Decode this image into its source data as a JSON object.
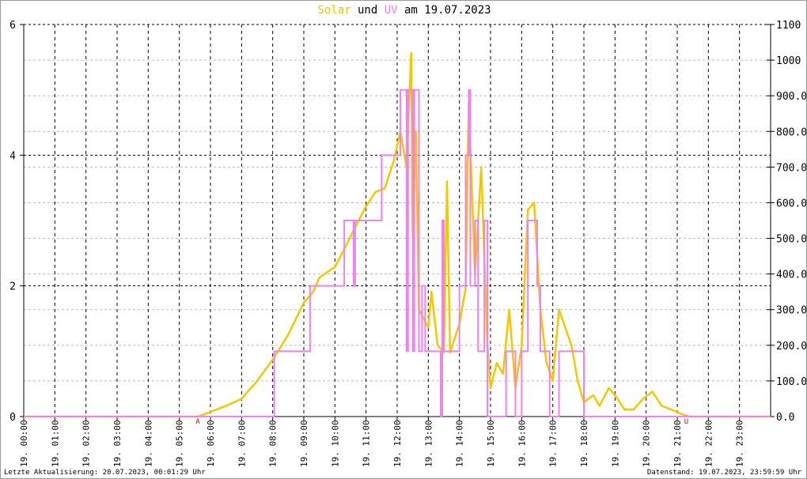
{
  "title": {
    "solar": "Solar",
    "und": " und ",
    "uv": "UV",
    "rest": " am 19.07.2023"
  },
  "footer": {
    "left": "Letzte Aktualisierung: 20.07.2023, 00:01:29 Uhr",
    "right": "Datenstand: 19.07.2023, 23:59:59 Uhr"
  },
  "markers": {
    "sunrise": "A",
    "sunset": "U",
    "sunrise_hour": 5.6,
    "sunset_hour": 21.3
  },
  "colors": {
    "solar": "#f2c800",
    "uv": "#ee82ee",
    "marker": "#e00000"
  },
  "chart_data": {
    "type": "line",
    "title": "Solar und UV am 19.07.2023",
    "x_unit": "hour",
    "xlim": [
      0,
      24
    ],
    "x_tick_labels": [
      "19. 00:00",
      "19. 01:00",
      "19. 02:00",
      "19. 03:00",
      "19. 04:00",
      "19. 05:00",
      "19. 06:00",
      "19. 07:00",
      "19. 08:00",
      "19. 09:00",
      "19. 10:00",
      "19. 11:00",
      "19. 12:00",
      "19. 13:00",
      "19. 14:00",
      "19. 15:00",
      "19. 16:00",
      "19. 17:00",
      "19. 18:00",
      "19. 19:00",
      "19. 20:00",
      "19. 21:00",
      "19. 22:00",
      "19. 23:00"
    ],
    "y_left": {
      "label": "UV",
      "ylim": [
        0,
        6
      ],
      "ticks": [
        "0",
        "2",
        "4",
        "6"
      ]
    },
    "y_right": {
      "label": "Solar",
      "ylim": [
        0,
        1100
      ],
      "ticks": [
        "0.0",
        "100.0",
        "200.0",
        "300.0",
        "400.0",
        "500.0",
        "600.0",
        "700.0",
        "800.0",
        "900.0",
        "1000",
        "1100"
      ]
    },
    "grid": true,
    "series": [
      {
        "name": "Solar",
        "axis": "right",
        "points": [
          [
            0,
            0
          ],
          [
            5.6,
            0
          ],
          [
            5.9,
            10
          ],
          [
            6.5,
            30
          ],
          [
            7.0,
            50
          ],
          [
            7.5,
            100
          ],
          [
            8.0,
            160
          ],
          [
            8.5,
            230
          ],
          [
            9.0,
            320
          ],
          [
            9.3,
            350
          ],
          [
            9.5,
            390
          ],
          [
            10.0,
            420
          ],
          [
            10.3,
            470
          ],
          [
            10.7,
            540
          ],
          [
            11.0,
            590
          ],
          [
            11.3,
            630
          ],
          [
            11.6,
            640
          ],
          [
            11.9,
            720
          ],
          [
            12.1,
            800
          ],
          [
            12.3,
            700
          ],
          [
            12.45,
            1020
          ],
          [
            12.5,
            500
          ],
          [
            12.6,
            800
          ],
          [
            12.7,
            300
          ],
          [
            13.0,
            250
          ],
          [
            13.1,
            350
          ],
          [
            13.3,
            200
          ],
          [
            13.5,
            180
          ],
          [
            13.6,
            660
          ],
          [
            13.7,
            180
          ],
          [
            14.0,
            260
          ],
          [
            14.2,
            360
          ],
          [
            14.3,
            880
          ],
          [
            14.5,
            400
          ],
          [
            14.7,
            700
          ],
          [
            14.9,
            200
          ],
          [
            15.0,
            80
          ],
          [
            15.2,
            150
          ],
          [
            15.4,
            120
          ],
          [
            15.6,
            300
          ],
          [
            15.8,
            80
          ],
          [
            16.0,
            200
          ],
          [
            16.2,
            580
          ],
          [
            16.4,
            600
          ],
          [
            16.6,
            300
          ],
          [
            16.8,
            150
          ],
          [
            17.0,
            100
          ],
          [
            17.2,
            300
          ],
          [
            17.4,
            250
          ],
          [
            17.6,
            200
          ],
          [
            17.8,
            100
          ],
          [
            18.0,
            40
          ],
          [
            18.3,
            60
          ],
          [
            18.5,
            30
          ],
          [
            18.8,
            80
          ],
          [
            19.0,
            60
          ],
          [
            19.3,
            20
          ],
          [
            19.6,
            20
          ],
          [
            19.9,
            50
          ],
          [
            20.2,
            70
          ],
          [
            20.5,
            30
          ],
          [
            20.8,
            20
          ],
          [
            21.2,
            5
          ],
          [
            21.4,
            0
          ],
          [
            24,
            0
          ]
        ]
      },
      {
        "name": "UV",
        "axis": "left",
        "steps": [
          [
            0,
            0
          ],
          [
            8.05,
            1
          ],
          [
            9.2,
            2
          ],
          [
            10.3,
            3
          ],
          [
            10.6,
            2
          ],
          [
            10.65,
            3
          ],
          [
            11.5,
            4
          ],
          [
            12.1,
            5
          ],
          [
            12.3,
            1
          ],
          [
            12.35,
            5
          ],
          [
            12.5,
            1
          ],
          [
            12.55,
            5
          ],
          [
            12.7,
            1
          ],
          [
            12.8,
            2
          ],
          [
            12.9,
            1
          ],
          [
            13.4,
            0
          ],
          [
            13.45,
            3
          ],
          [
            13.5,
            1
          ],
          [
            14.0,
            2
          ],
          [
            14.2,
            4
          ],
          [
            14.3,
            5
          ],
          [
            14.35,
            2
          ],
          [
            14.5,
            3
          ],
          [
            14.6,
            1
          ],
          [
            14.8,
            3
          ],
          [
            14.9,
            0
          ],
          [
            15.5,
            1
          ],
          [
            15.8,
            0
          ],
          [
            16.0,
            1
          ],
          [
            16.2,
            3
          ],
          [
            16.5,
            2
          ],
          [
            16.6,
            1
          ],
          [
            16.9,
            0
          ],
          [
            17.2,
            1
          ],
          [
            18.0,
            0
          ],
          [
            24,
            0
          ]
        ]
      }
    ]
  }
}
